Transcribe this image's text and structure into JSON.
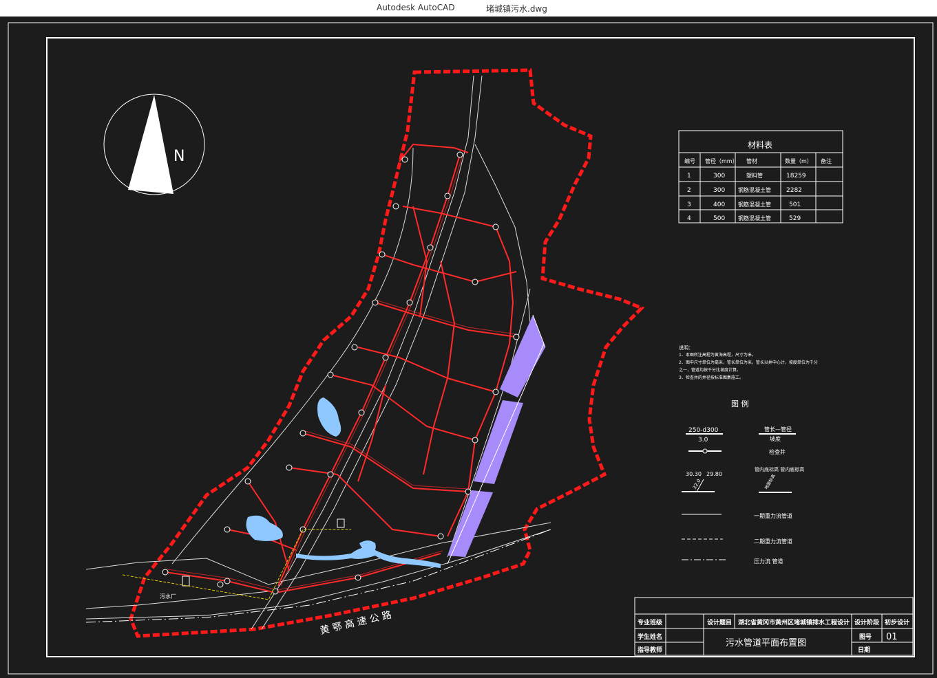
{
  "window": {
    "app_name": "Autodesk AutoCAD",
    "file_name": "堵城镇污水.dwg"
  },
  "drawing": {
    "north_label": "N",
    "highway_label": "黄 鄂 高 速 公 路",
    "plant_label": "污水厂",
    "material_table": {
      "title": "材料表",
      "headers": [
        "编号",
        "管径（mm）",
        "管材",
        "数量（m）",
        "备注"
      ],
      "rows": [
        [
          "1",
          "300",
          "塑料管",
          "18259",
          ""
        ],
        [
          "2",
          "300",
          "钢筋混凝土管",
          "2282",
          ""
        ],
        [
          "3",
          "400",
          "钢筋混凝土管",
          "501",
          ""
        ],
        [
          "4",
          "500",
          "钢筋混凝土管",
          "529",
          ""
        ]
      ]
    },
    "notes": {
      "title": "说明：",
      "lines": [
        "1、本图所注高程为黄海高程，尺寸为米。",
        "2、图中尺寸单位为毫米，管长单位为米，管长以井中心计，坡度单位为千分",
        "之一，管道均按千分比坡度计算。",
        "3、检查井的井径按标准图集施工。"
      ]
    },
    "legend": {
      "title": "图  例",
      "sample_top": "250-d300",
      "sample_bottom": "3.0",
      "desc_top": "管长—管径",
      "desc_bottom": "坡度",
      "manhole": "检查井",
      "elev_left": "30.30",
      "elev_right": "29.80",
      "elev_ground": "32.0",
      "elev_desc": "管内底标高  管内底标高",
      "elev_desc2": "地面标高",
      "gravity1": "一期重力流管道",
      "gravity2": "二期重力流管道",
      "pressure": "压力流 管道"
    },
    "title_block": {
      "major": "专业班级",
      "student": "学生姓名",
      "advisor": "指导教师",
      "design_topic_label": "设计题目",
      "design_topic": "湖北省黄冈市黄州区堵城镇排水工程设计",
      "design_stage_label": "设计阶段",
      "design_stage": "初步设计",
      "drawing_name": "污水管道平面布置图",
      "drawing_no_label": "图号",
      "drawing_no": "01",
      "date_label": "日期"
    }
  },
  "colors": {
    "boundary": "#ff1a1a",
    "pipe": "#ff1a1a",
    "water": "#8ec8ff",
    "channel": "#a78bfa",
    "background": "#1c1c1c"
  }
}
